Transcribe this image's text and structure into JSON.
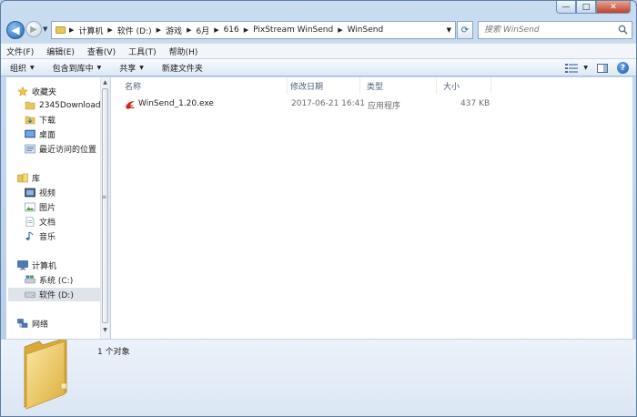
{
  "window": {
    "caption_buttons": {
      "minimize": "—",
      "maximize": "□",
      "close": "✕"
    }
  },
  "address_bar": {
    "crumbs": [
      "计算机",
      "软件 (D:)",
      "游戏",
      "6月",
      "616",
      "PixStream WinSend",
      "WinSend"
    ],
    "search_placeholder": "搜索 WinSend"
  },
  "menu": [
    "文件(F)",
    "编辑(E)",
    "查看(V)",
    "工具(T)",
    "帮助(H)"
  ],
  "toolbar": {
    "organize": "组织",
    "include_in_library": "包含到库中",
    "share": "共享",
    "new_folder": "新建文件夹"
  },
  "nav_pane": {
    "favorites": {
      "label": "收藏夹",
      "items": [
        "2345Downloads",
        "下载",
        "桌面",
        "最近访问的位置"
      ]
    },
    "libraries": {
      "label": "库",
      "items": [
        "视频",
        "图片",
        "文档",
        "音乐"
      ]
    },
    "computer": {
      "label": "计算机",
      "items": [
        "系统 (C:)",
        "软件 (D:)"
      ]
    },
    "network": {
      "label": "网络"
    }
  },
  "columns": [
    "名称",
    "修改日期",
    "类型",
    "大小"
  ],
  "files": [
    {
      "name": "WinSend_1.20.exe",
      "modified": "2017-06-21 16:41",
      "type": "应用程序",
      "size": "437 KB",
      "icon": "winsend-exe-icon"
    }
  ],
  "details": {
    "count_text": "1 个对象"
  },
  "colors": {
    "accent_blue": "#1f5fb0",
    "folder_yellow": "#e9c65b",
    "exe_red": "#d9261c"
  }
}
